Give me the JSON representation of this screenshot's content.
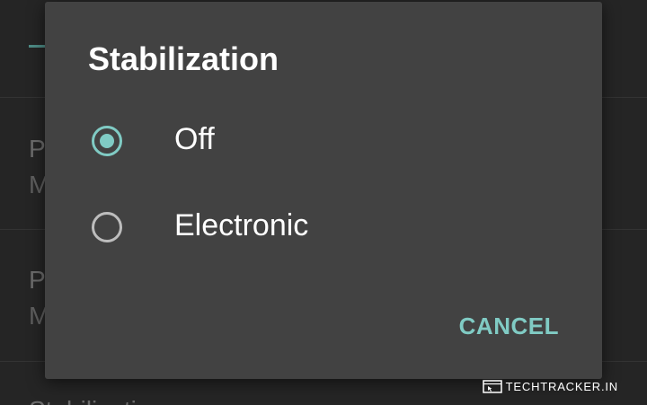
{
  "background": {
    "items": [
      {
        "title": "P",
        "subtitle": "M"
      },
      {
        "title": "P",
        "subtitle": "M"
      },
      {
        "title": "Stabilizatio",
        "subtitle": ""
      }
    ]
  },
  "dialog": {
    "title": "Stabilization",
    "options": [
      {
        "label": "Off",
        "selected": true
      },
      {
        "label": "Electronic",
        "selected": false
      }
    ],
    "cancel_label": "CANCEL"
  },
  "watermark": {
    "text": "TECHTRACKER.IN"
  },
  "colors": {
    "accent": "#80cbc4",
    "dialog_bg": "#424242",
    "screen_bg": "#252525"
  }
}
